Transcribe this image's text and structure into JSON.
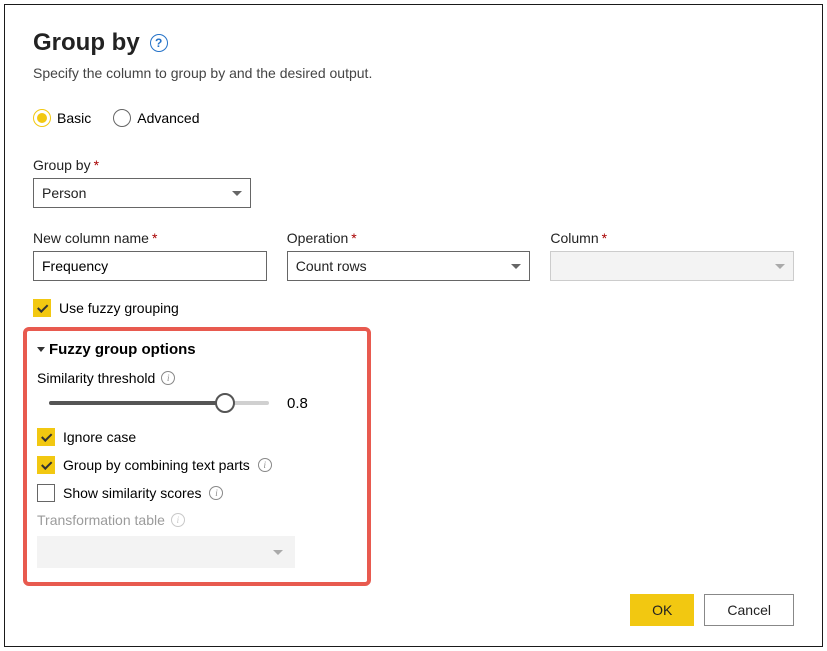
{
  "header": {
    "title": "Group by",
    "subtitle": "Specify the column to group by and the desired output."
  },
  "mode": {
    "basic": "Basic",
    "advanced": "Advanced"
  },
  "groupBy": {
    "label": "Group by",
    "value": "Person"
  },
  "newColumn": {
    "label": "New column name",
    "value": "Frequency"
  },
  "operation": {
    "label": "Operation",
    "value": "Count rows"
  },
  "column": {
    "label": "Column"
  },
  "fuzzyCheck": "Use fuzzy grouping",
  "options": {
    "title": "Fuzzy group options",
    "similarity": "Similarity threshold",
    "similarityValue": "0.8",
    "ignoreCase": "Ignore case",
    "combineParts": "Group by combining text parts",
    "showScores": "Show similarity scores",
    "transTable": "Transformation table"
  },
  "buttons": {
    "ok": "OK",
    "cancel": "Cancel"
  }
}
